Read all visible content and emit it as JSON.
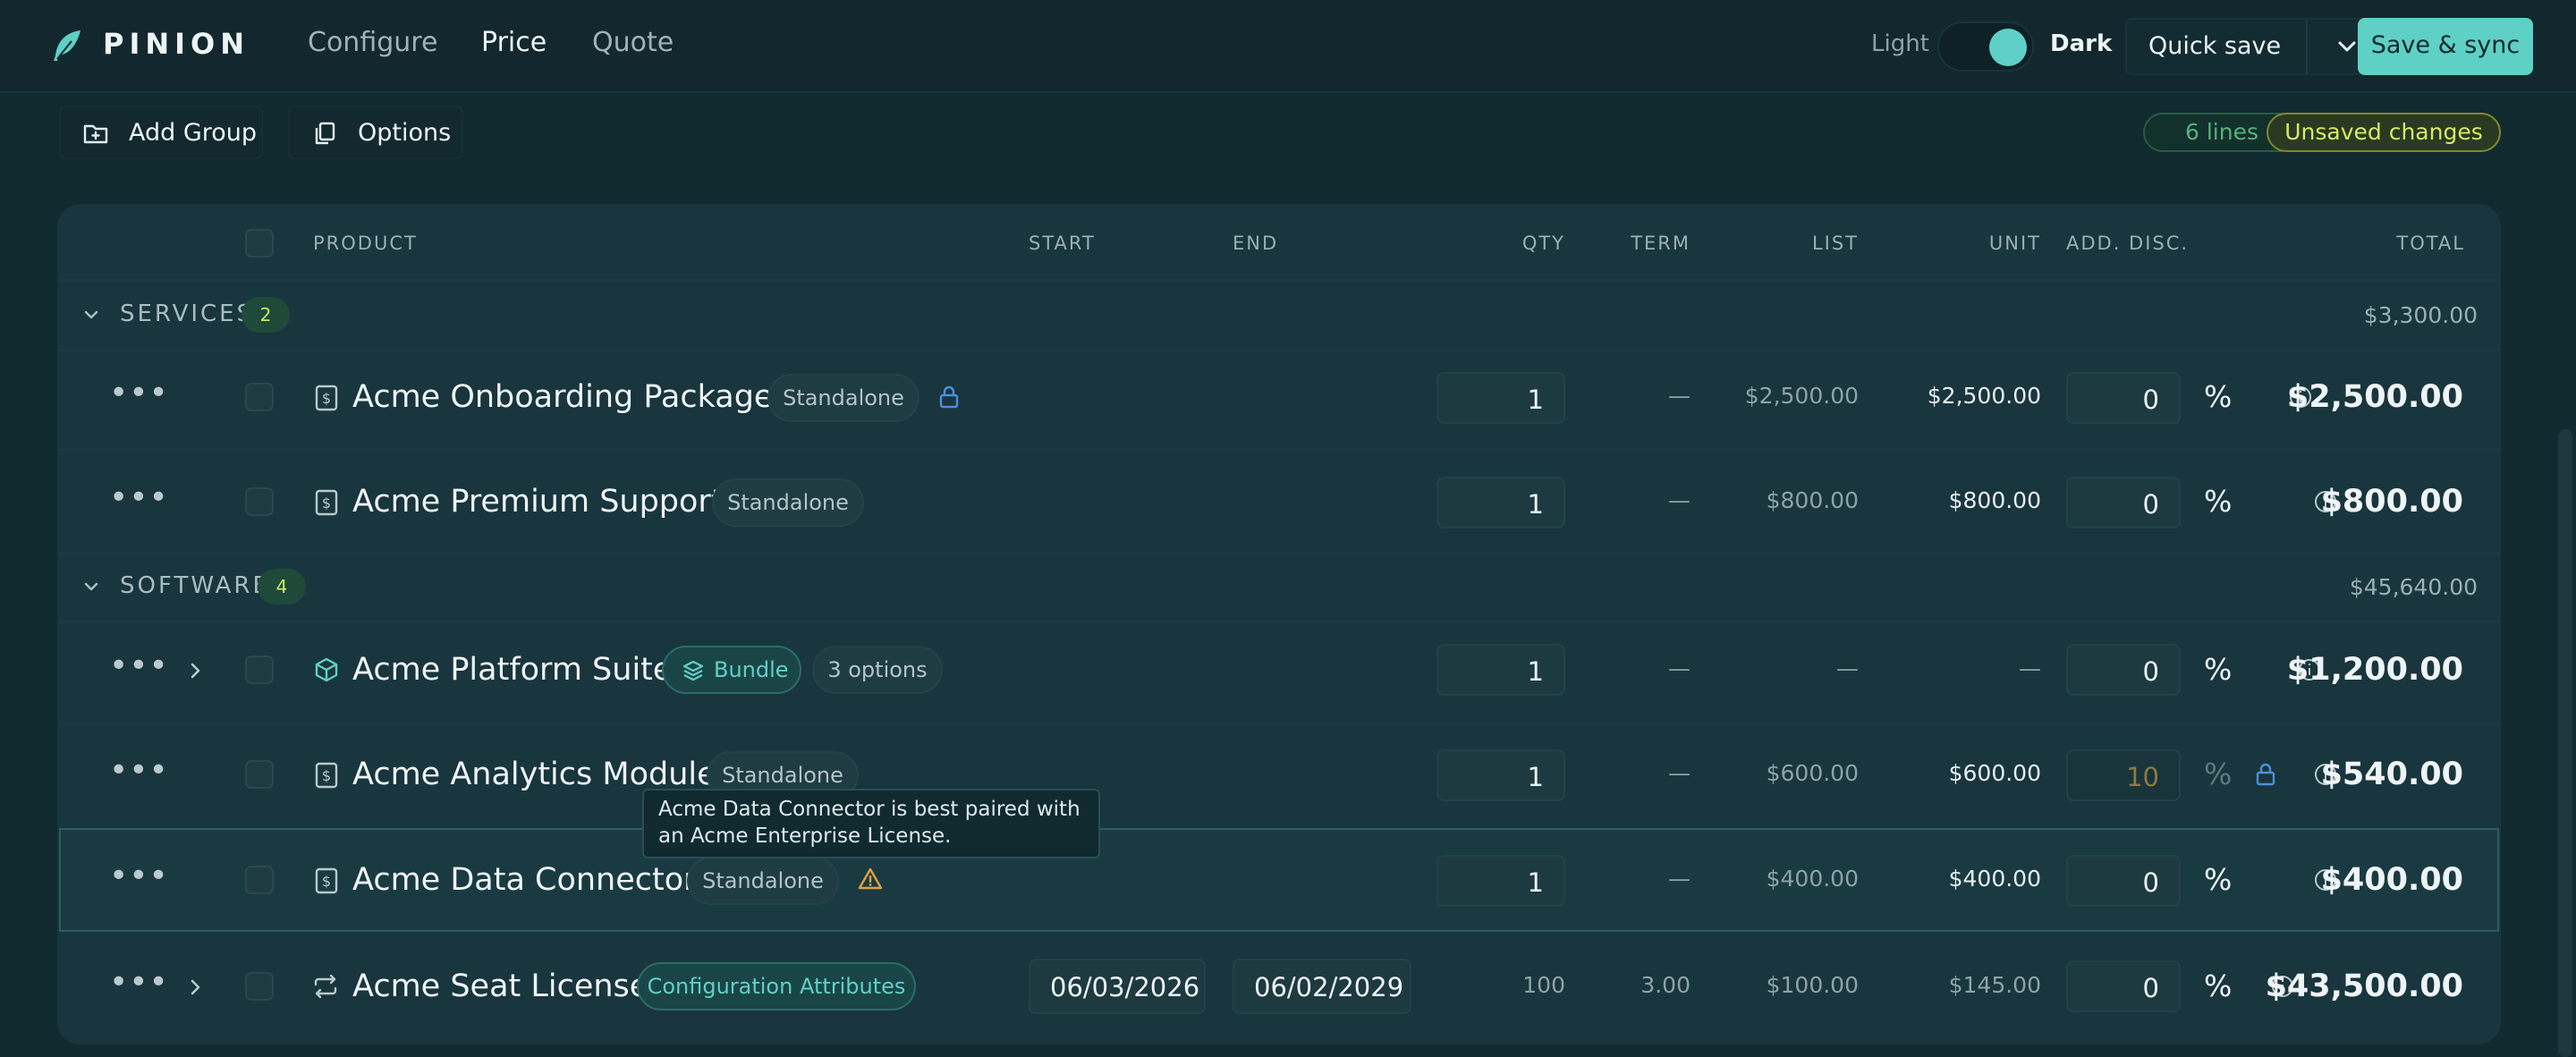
{
  "app": {
    "brand": "PINION",
    "nav": [
      {
        "label": "Configure",
        "active": false
      },
      {
        "label": "Price",
        "active": true
      },
      {
        "label": "Quote",
        "active": false
      }
    ],
    "theme": {
      "light_label": "Light",
      "dark_label": "Dark",
      "selected": "Dark"
    },
    "quick_save_label": "Quick save",
    "save_sync_label": "Save & sync"
  },
  "toolbar": {
    "add_group_label": "Add Group",
    "options_label": "Options",
    "lines_count": "6 lines",
    "unsaved_label": "Unsaved changes"
  },
  "table": {
    "headers": {
      "product": "PRODUCT",
      "start": "START",
      "end": "END",
      "qty": "QTY",
      "term": "TERM",
      "list": "LIST",
      "unit": "UNIT",
      "disc": "ADD. DISC.",
      "total": "TOTAL"
    },
    "groups": [
      {
        "name": "SERVICES",
        "count": "2",
        "total": "$3,300.00",
        "rows": [
          {
            "name": "Acme Onboarding Package",
            "tag": "Standalone",
            "qty": "1",
            "term": "—",
            "list": "$2,500.00",
            "unit": "$2,500.00",
            "disc": "0",
            "pct": "%",
            "total": "$2,500.00",
            "icon": "dollar-doc-icon",
            "locked": true
          },
          {
            "name": "Acme Premium Support",
            "tag": "Standalone",
            "qty": "1",
            "term": "—",
            "list": "$800.00",
            "unit": "$800.00",
            "disc": "0",
            "pct": "%",
            "total": "$800.00",
            "icon": "dollar-doc-icon"
          }
        ]
      },
      {
        "name": "SOFTWARE",
        "count": "4",
        "total": "$45,640.00",
        "rows": [
          {
            "name": "Acme Platform Suite",
            "tag": "Bundle",
            "options": "3 options",
            "qty": "1",
            "term": "—",
            "list": "—",
            "unit": "—",
            "disc": "0",
            "pct": "%",
            "total": "$1,200.00",
            "icon": "cube-icon",
            "expandable": true
          },
          {
            "name": "Acme Analytics Module",
            "tag": "Standalone",
            "qty": "1",
            "term": "—",
            "list": "$600.00",
            "unit": "$600.00",
            "disc": "10",
            "pct": "%",
            "total": "$540.00",
            "icon": "dollar-doc-icon",
            "disc_locked": true
          },
          {
            "name": "Acme Data Connector",
            "tag": "Standalone",
            "qty": "1",
            "term": "—",
            "list": "$400.00",
            "unit": "$400.00",
            "disc": "0",
            "pct": "%",
            "total": "$400.00",
            "icon": "dollar-doc-icon",
            "warning": true,
            "selected": true
          },
          {
            "name": "Acme Seat License",
            "tag": "Configuration Attributes",
            "start": "06/03/2026",
            "end": "06/02/2029",
            "qty": "100",
            "term": "3.00",
            "list": "$100.00",
            "unit": "$145.00",
            "disc": "0",
            "pct": "%",
            "total": "$43,500.00",
            "icon": "recurring-icon",
            "expandable": true
          }
        ]
      }
    ]
  },
  "tooltip": {
    "text": "Acme Data Connector is best paired with an Acme Enterprise License."
  },
  "colors": {
    "accent": "#5fd0c5",
    "background": "#112a30",
    "panel": "#19353d",
    "warning": "#e0a040",
    "lock_blue": "#4a90d9"
  }
}
